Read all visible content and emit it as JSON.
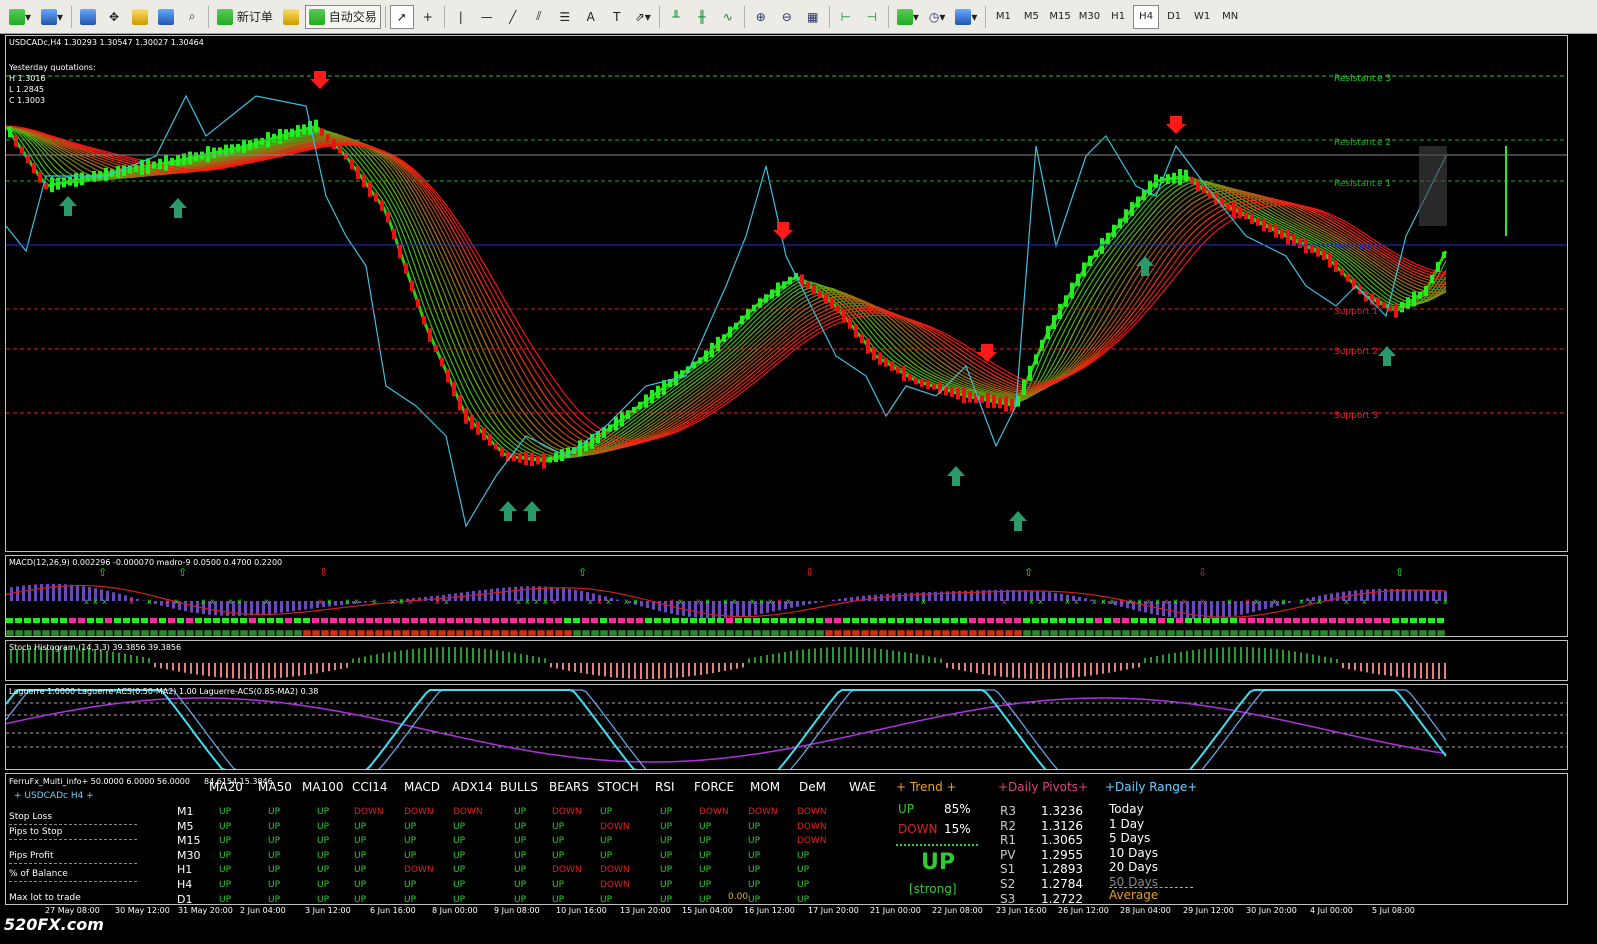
{
  "toolbar": {
    "new_order": "新订单",
    "auto_trade": "自动交易",
    "timeframes": [
      "M1",
      "M5",
      "M15",
      "M30",
      "H1",
      "H4",
      "D1",
      "W1",
      "MN"
    ],
    "active_timeframe": "H4"
  },
  "main_chart": {
    "header": "USDCADc,H4  1.30293 1.30547 1.30027 1.30464",
    "yesterday_title": "Yesterday quotations:",
    "yesterday_h": "H 1.3016",
    "yesterday_l": "L 1.2845",
    "yesterday_c": "C 1.3003",
    "levels": [
      {
        "name": "Resistance 3",
        "color": "#22cc22"
      },
      {
        "name": "Resistance 2",
        "color": "#22aa22"
      },
      {
        "name": "Resistance 1",
        "color": "#22aa22"
      },
      {
        "name": "Pivot level",
        "color": "#2233cc"
      },
      {
        "name": "Support 1",
        "color": "#cc2222"
      },
      {
        "name": "Support 2",
        "color": "#dd2222"
      },
      {
        "name": "Support 3",
        "color": "#ee2222"
      }
    ]
  },
  "macd": {
    "title": "MACD(12,26,9) 0.002296 -0.000070   madro-9 0.0500 0.4700 0.2200"
  },
  "stoch": {
    "title": "Stoch Histogram (14,3,3) 39.3856 39.3856"
  },
  "laguerre": {
    "title": "Laguerre 1.0000   Laguerre-ACS(0.50-MA2) 1.00   Laguerre-ACS(0.85-MA2) 0.38"
  },
  "info": {
    "title": "FerruFx_Multi_info+ 50.0000 6.0000 56.0000",
    "title_values": "84.6154 15.3846",
    "symbol": "+  USDCADc  H4  +",
    "left_labels": [
      "Stop Loss",
      "Pips to Stop",
      "Pips Profit",
      "% of Balance",
      "Max lot to trade"
    ],
    "small_value": "0.00",
    "columns": [
      "MA20",
      "MA50",
      "MA100",
      "CCI14",
      "MACD",
      "ADX14",
      "BULLS",
      "BEARS",
      "STOCH",
      "RSI",
      "FORCE",
      "MOM",
      "DeM",
      "WAE"
    ],
    "rows": [
      {
        "tf": "M1",
        "vals": [
          "UP",
          "UP",
          "UP",
          "DOWN",
          "DOWN",
          "DOWN",
          "UP",
          "DOWN",
          "UP",
          "UP",
          "DOWN",
          "DOWN",
          "DOWN"
        ]
      },
      {
        "tf": "M5",
        "vals": [
          "UP",
          "UP",
          "UP",
          "UP",
          "UP",
          "UP",
          "UP",
          "UP",
          "DOWN",
          "UP",
          "UP",
          "UP",
          "DOWN"
        ]
      },
      {
        "tf": "M15",
        "vals": [
          "UP",
          "UP",
          "UP",
          "UP",
          "UP",
          "UP",
          "UP",
          "UP",
          "UP",
          "UP",
          "UP",
          "UP",
          "DOWN"
        ]
      },
      {
        "tf": "M30",
        "vals": [
          "UP",
          "UP",
          "UP",
          "UP",
          "UP",
          "UP",
          "UP",
          "UP",
          "UP",
          "UP",
          "UP",
          "UP",
          "UP"
        ]
      },
      {
        "tf": "H1",
        "vals": [
          "UP",
          "UP",
          "UP",
          "UP",
          "DOWN",
          "UP",
          "UP",
          "DOWN",
          "DOWN",
          "UP",
          "UP",
          "UP",
          "UP"
        ]
      },
      {
        "tf": "H4",
        "vals": [
          "UP",
          "UP",
          "UP",
          "UP",
          "UP",
          "UP",
          "UP",
          "UP",
          "DOWN",
          "UP",
          "UP",
          "UP",
          "UP"
        ]
      },
      {
        "tf": "D1",
        "vals": [
          "UP",
          "UP",
          "UP",
          "UP",
          "UP",
          "UP",
          "UP",
          "UP",
          "UP",
          "UP",
          "UP",
          "UP",
          "UP"
        ]
      }
    ],
    "trend_title": "+  Trend  +",
    "trend_up_label": "UP",
    "trend_up_pct": "85%",
    "trend_down_label": "DOWN",
    "trend_down_pct": "15%",
    "trend_big": "UP",
    "trend_strength": "[strong]",
    "pivots_title": "+Daily Pivots+",
    "pivots": [
      {
        "name": "R3",
        "value": "1.3236"
      },
      {
        "name": "R2",
        "value": "1.3126"
      },
      {
        "name": "R1",
        "value": "1.3065"
      },
      {
        "name": "PV",
        "value": "1.2955"
      },
      {
        "name": "S1",
        "value": "1.2893"
      },
      {
        "name": "S2",
        "value": "1.2784"
      },
      {
        "name": "S3",
        "value": "1.2722"
      }
    ],
    "range_title": "+Daily Range+",
    "ranges": [
      "Today",
      "1 Day",
      "5 Days",
      "10 Days",
      "20 Days",
      "50 Days"
    ],
    "range_average": "Average"
  },
  "time_labels": [
    "27 May 08:00",
    "30 May 12:00",
    "31 May 20:00",
    "2 Jun 04:00",
    "3 Jun 12:00",
    "6 Jun 16:00",
    "8 Jun 00:00",
    "9 Jun 08:00",
    "10 Jun 16:00",
    "13 Jun 20:00",
    "15 Jun 04:00",
    "16 Jun 12:00",
    "17 Jun 20:00",
    "21 Jun 00:00",
    "22 Jun 08:00",
    "23 Jun 16:00",
    "26 Jun 12:00",
    "28 Jun 04:00",
    "29 Jun 12:00",
    "30 Jun 20:00",
    "4 Jul 00:00",
    "5 Jul 08:00"
  ],
  "watermark": "520FX.com"
}
